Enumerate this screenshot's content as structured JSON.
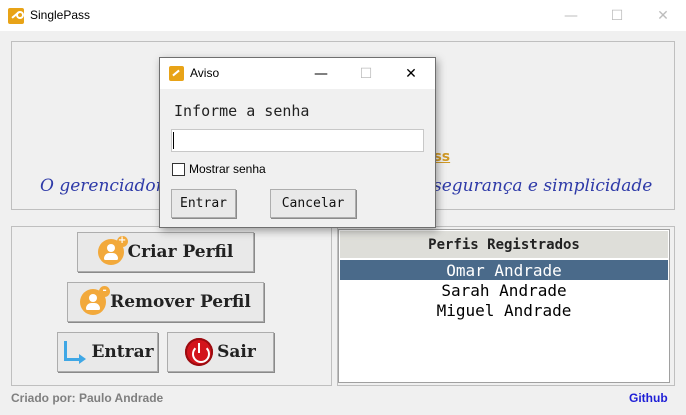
{
  "window": {
    "title": "SinglePass",
    "minimize": "—",
    "maximize": "☐",
    "close": "✕"
  },
  "banner": {
    "headline_fragment": "ass",
    "tagline_left": "O gerenciador",
    "tagline_right": "segurança e simplicidade"
  },
  "actions": {
    "create_profile": "Criar Perfil",
    "create_badge": "+",
    "remove_profile": "Remover Perfil",
    "remove_badge": "-",
    "enter": "Entrar",
    "exit": "Sair"
  },
  "profiles": {
    "header": "Perfis Registrados",
    "items": [
      "Omar Andrade",
      "Sarah Andrade",
      "Miguel Andrade"
    ],
    "selected_index": 0
  },
  "footer": {
    "credit": "Criado por: Paulo Andrade",
    "link": "Github"
  },
  "dialog": {
    "title": "Aviso",
    "minimize": "—",
    "maximize": "☐",
    "close": "✕",
    "prompt": "Informe a senha",
    "password_value": "",
    "show_password_label": "Mostrar senha",
    "show_password_checked": false,
    "ok_label": "Entrar",
    "cancel_label": "Cancelar"
  },
  "colors": {
    "accent_gold": "#d19a26",
    "tagline_blue": "#2e3aa8",
    "selection": "#4a6a8a",
    "link_blue": "#1e1ed6",
    "exit_red": "#d3141c",
    "avatar_orange": "#f2a93b"
  }
}
